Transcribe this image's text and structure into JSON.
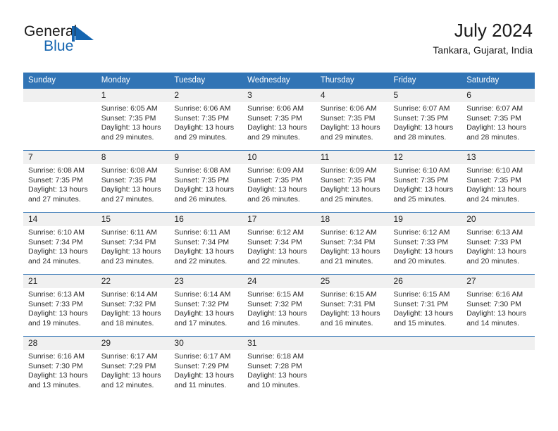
{
  "brand": {
    "name_part1": "General",
    "name_part2": "Blue",
    "mark": "triangle-flag-icon",
    "accent_color": "#1565b0"
  },
  "header": {
    "title": "July 2024",
    "subtitle": "Tankara, Gujarat, India"
  },
  "theme": {
    "header_blue": "#3174b5",
    "daynum_band": "#f0f0f0",
    "separator": "#3174b5",
    "text": "#2b2b2b"
  },
  "weekdays": [
    "Sunday",
    "Monday",
    "Tuesday",
    "Wednesday",
    "Thursday",
    "Friday",
    "Saturday"
  ],
  "weeks": [
    {
      "days": [
        {
          "num": "",
          "sunrise": "",
          "sunset": "",
          "daylight_line1": "",
          "daylight_line2": ""
        },
        {
          "num": "1",
          "sunrise": "Sunrise: 6:05 AM",
          "sunset": "Sunset: 7:35 PM",
          "daylight_line1": "Daylight: 13 hours",
          "daylight_line2": "and 29 minutes."
        },
        {
          "num": "2",
          "sunrise": "Sunrise: 6:06 AM",
          "sunset": "Sunset: 7:35 PM",
          "daylight_line1": "Daylight: 13 hours",
          "daylight_line2": "and 29 minutes."
        },
        {
          "num": "3",
          "sunrise": "Sunrise: 6:06 AM",
          "sunset": "Sunset: 7:35 PM",
          "daylight_line1": "Daylight: 13 hours",
          "daylight_line2": "and 29 minutes."
        },
        {
          "num": "4",
          "sunrise": "Sunrise: 6:06 AM",
          "sunset": "Sunset: 7:35 PM",
          "daylight_line1": "Daylight: 13 hours",
          "daylight_line2": "and 29 minutes."
        },
        {
          "num": "5",
          "sunrise": "Sunrise: 6:07 AM",
          "sunset": "Sunset: 7:35 PM",
          "daylight_line1": "Daylight: 13 hours",
          "daylight_line2": "and 28 minutes."
        },
        {
          "num": "6",
          "sunrise": "Sunrise: 6:07 AM",
          "sunset": "Sunset: 7:35 PM",
          "daylight_line1": "Daylight: 13 hours",
          "daylight_line2": "and 28 minutes."
        }
      ]
    },
    {
      "days": [
        {
          "num": "7",
          "sunrise": "Sunrise: 6:08 AM",
          "sunset": "Sunset: 7:35 PM",
          "daylight_line1": "Daylight: 13 hours",
          "daylight_line2": "and 27 minutes."
        },
        {
          "num": "8",
          "sunrise": "Sunrise: 6:08 AM",
          "sunset": "Sunset: 7:35 PM",
          "daylight_line1": "Daylight: 13 hours",
          "daylight_line2": "and 27 minutes."
        },
        {
          "num": "9",
          "sunrise": "Sunrise: 6:08 AM",
          "sunset": "Sunset: 7:35 PM",
          "daylight_line1": "Daylight: 13 hours",
          "daylight_line2": "and 26 minutes."
        },
        {
          "num": "10",
          "sunrise": "Sunrise: 6:09 AM",
          "sunset": "Sunset: 7:35 PM",
          "daylight_line1": "Daylight: 13 hours",
          "daylight_line2": "and 26 minutes."
        },
        {
          "num": "11",
          "sunrise": "Sunrise: 6:09 AM",
          "sunset": "Sunset: 7:35 PM",
          "daylight_line1": "Daylight: 13 hours",
          "daylight_line2": "and 25 minutes."
        },
        {
          "num": "12",
          "sunrise": "Sunrise: 6:10 AM",
          "sunset": "Sunset: 7:35 PM",
          "daylight_line1": "Daylight: 13 hours",
          "daylight_line2": "and 25 minutes."
        },
        {
          "num": "13",
          "sunrise": "Sunrise: 6:10 AM",
          "sunset": "Sunset: 7:35 PM",
          "daylight_line1": "Daylight: 13 hours",
          "daylight_line2": "and 24 minutes."
        }
      ]
    },
    {
      "days": [
        {
          "num": "14",
          "sunrise": "Sunrise: 6:10 AM",
          "sunset": "Sunset: 7:34 PM",
          "daylight_line1": "Daylight: 13 hours",
          "daylight_line2": "and 24 minutes."
        },
        {
          "num": "15",
          "sunrise": "Sunrise: 6:11 AM",
          "sunset": "Sunset: 7:34 PM",
          "daylight_line1": "Daylight: 13 hours",
          "daylight_line2": "and 23 minutes."
        },
        {
          "num": "16",
          "sunrise": "Sunrise: 6:11 AM",
          "sunset": "Sunset: 7:34 PM",
          "daylight_line1": "Daylight: 13 hours",
          "daylight_line2": "and 22 minutes."
        },
        {
          "num": "17",
          "sunrise": "Sunrise: 6:12 AM",
          "sunset": "Sunset: 7:34 PM",
          "daylight_line1": "Daylight: 13 hours",
          "daylight_line2": "and 22 minutes."
        },
        {
          "num": "18",
          "sunrise": "Sunrise: 6:12 AM",
          "sunset": "Sunset: 7:34 PM",
          "daylight_line1": "Daylight: 13 hours",
          "daylight_line2": "and 21 minutes."
        },
        {
          "num": "19",
          "sunrise": "Sunrise: 6:12 AM",
          "sunset": "Sunset: 7:33 PM",
          "daylight_line1": "Daylight: 13 hours",
          "daylight_line2": "and 20 minutes."
        },
        {
          "num": "20",
          "sunrise": "Sunrise: 6:13 AM",
          "sunset": "Sunset: 7:33 PM",
          "daylight_line1": "Daylight: 13 hours",
          "daylight_line2": "and 20 minutes."
        }
      ]
    },
    {
      "days": [
        {
          "num": "21",
          "sunrise": "Sunrise: 6:13 AM",
          "sunset": "Sunset: 7:33 PM",
          "daylight_line1": "Daylight: 13 hours",
          "daylight_line2": "and 19 minutes."
        },
        {
          "num": "22",
          "sunrise": "Sunrise: 6:14 AM",
          "sunset": "Sunset: 7:32 PM",
          "daylight_line1": "Daylight: 13 hours",
          "daylight_line2": "and 18 minutes."
        },
        {
          "num": "23",
          "sunrise": "Sunrise: 6:14 AM",
          "sunset": "Sunset: 7:32 PM",
          "daylight_line1": "Daylight: 13 hours",
          "daylight_line2": "and 17 minutes."
        },
        {
          "num": "24",
          "sunrise": "Sunrise: 6:15 AM",
          "sunset": "Sunset: 7:32 PM",
          "daylight_line1": "Daylight: 13 hours",
          "daylight_line2": "and 16 minutes."
        },
        {
          "num": "25",
          "sunrise": "Sunrise: 6:15 AM",
          "sunset": "Sunset: 7:31 PM",
          "daylight_line1": "Daylight: 13 hours",
          "daylight_line2": "and 16 minutes."
        },
        {
          "num": "26",
          "sunrise": "Sunrise: 6:15 AM",
          "sunset": "Sunset: 7:31 PM",
          "daylight_line1": "Daylight: 13 hours",
          "daylight_line2": "and 15 minutes."
        },
        {
          "num": "27",
          "sunrise": "Sunrise: 6:16 AM",
          "sunset": "Sunset: 7:30 PM",
          "daylight_line1": "Daylight: 13 hours",
          "daylight_line2": "and 14 minutes."
        }
      ]
    },
    {
      "days": [
        {
          "num": "28",
          "sunrise": "Sunrise: 6:16 AM",
          "sunset": "Sunset: 7:30 PM",
          "daylight_line1": "Daylight: 13 hours",
          "daylight_line2": "and 13 minutes."
        },
        {
          "num": "29",
          "sunrise": "Sunrise: 6:17 AM",
          "sunset": "Sunset: 7:29 PM",
          "daylight_line1": "Daylight: 13 hours",
          "daylight_line2": "and 12 minutes."
        },
        {
          "num": "30",
          "sunrise": "Sunrise: 6:17 AM",
          "sunset": "Sunset: 7:29 PM",
          "daylight_line1": "Daylight: 13 hours",
          "daylight_line2": "and 11 minutes."
        },
        {
          "num": "31",
          "sunrise": "Sunrise: 6:18 AM",
          "sunset": "Sunset: 7:28 PM",
          "daylight_line1": "Daylight: 13 hours",
          "daylight_line2": "and 10 minutes."
        },
        {
          "num": "",
          "sunrise": "",
          "sunset": "",
          "daylight_line1": "",
          "daylight_line2": ""
        },
        {
          "num": "",
          "sunrise": "",
          "sunset": "",
          "daylight_line1": "",
          "daylight_line2": ""
        },
        {
          "num": "",
          "sunrise": "",
          "sunset": "",
          "daylight_line1": "",
          "daylight_line2": ""
        }
      ]
    }
  ]
}
